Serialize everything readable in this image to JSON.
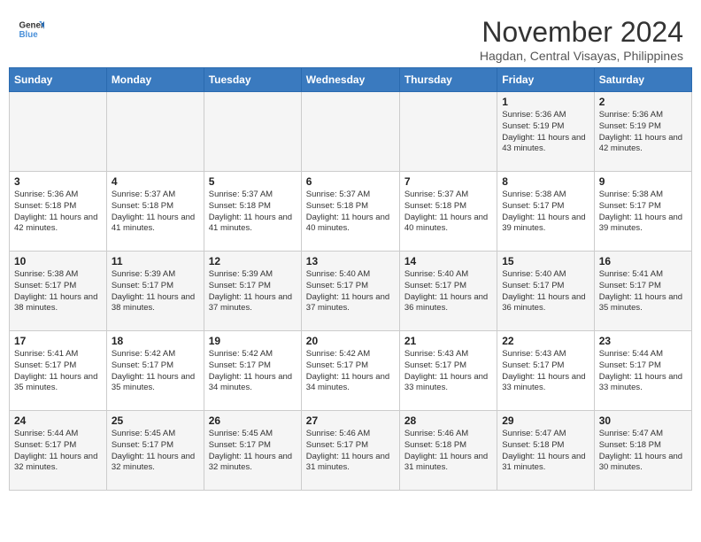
{
  "header": {
    "logo_line1": "General",
    "logo_line2": "Blue",
    "month": "November 2024",
    "location": "Hagdan, Central Visayas, Philippines"
  },
  "days_of_week": [
    "Sunday",
    "Monday",
    "Tuesday",
    "Wednesday",
    "Thursday",
    "Friday",
    "Saturday"
  ],
  "weeks": [
    [
      {
        "day": "",
        "info": ""
      },
      {
        "day": "",
        "info": ""
      },
      {
        "day": "",
        "info": ""
      },
      {
        "day": "",
        "info": ""
      },
      {
        "day": "",
        "info": ""
      },
      {
        "day": "1",
        "info": "Sunrise: 5:36 AM\nSunset: 5:19 PM\nDaylight: 11 hours and 43 minutes."
      },
      {
        "day": "2",
        "info": "Sunrise: 5:36 AM\nSunset: 5:19 PM\nDaylight: 11 hours and 42 minutes."
      }
    ],
    [
      {
        "day": "3",
        "info": "Sunrise: 5:36 AM\nSunset: 5:18 PM\nDaylight: 11 hours and 42 minutes."
      },
      {
        "day": "4",
        "info": "Sunrise: 5:37 AM\nSunset: 5:18 PM\nDaylight: 11 hours and 41 minutes."
      },
      {
        "day": "5",
        "info": "Sunrise: 5:37 AM\nSunset: 5:18 PM\nDaylight: 11 hours and 41 minutes."
      },
      {
        "day": "6",
        "info": "Sunrise: 5:37 AM\nSunset: 5:18 PM\nDaylight: 11 hours and 40 minutes."
      },
      {
        "day": "7",
        "info": "Sunrise: 5:37 AM\nSunset: 5:18 PM\nDaylight: 11 hours and 40 minutes."
      },
      {
        "day": "8",
        "info": "Sunrise: 5:38 AM\nSunset: 5:17 PM\nDaylight: 11 hours and 39 minutes."
      },
      {
        "day": "9",
        "info": "Sunrise: 5:38 AM\nSunset: 5:17 PM\nDaylight: 11 hours and 39 minutes."
      }
    ],
    [
      {
        "day": "10",
        "info": "Sunrise: 5:38 AM\nSunset: 5:17 PM\nDaylight: 11 hours and 38 minutes."
      },
      {
        "day": "11",
        "info": "Sunrise: 5:39 AM\nSunset: 5:17 PM\nDaylight: 11 hours and 38 minutes."
      },
      {
        "day": "12",
        "info": "Sunrise: 5:39 AM\nSunset: 5:17 PM\nDaylight: 11 hours and 37 minutes."
      },
      {
        "day": "13",
        "info": "Sunrise: 5:40 AM\nSunset: 5:17 PM\nDaylight: 11 hours and 37 minutes."
      },
      {
        "day": "14",
        "info": "Sunrise: 5:40 AM\nSunset: 5:17 PM\nDaylight: 11 hours and 36 minutes."
      },
      {
        "day": "15",
        "info": "Sunrise: 5:40 AM\nSunset: 5:17 PM\nDaylight: 11 hours and 36 minutes."
      },
      {
        "day": "16",
        "info": "Sunrise: 5:41 AM\nSunset: 5:17 PM\nDaylight: 11 hours and 35 minutes."
      }
    ],
    [
      {
        "day": "17",
        "info": "Sunrise: 5:41 AM\nSunset: 5:17 PM\nDaylight: 11 hours and 35 minutes."
      },
      {
        "day": "18",
        "info": "Sunrise: 5:42 AM\nSunset: 5:17 PM\nDaylight: 11 hours and 35 minutes."
      },
      {
        "day": "19",
        "info": "Sunrise: 5:42 AM\nSunset: 5:17 PM\nDaylight: 11 hours and 34 minutes."
      },
      {
        "day": "20",
        "info": "Sunrise: 5:42 AM\nSunset: 5:17 PM\nDaylight: 11 hours and 34 minutes."
      },
      {
        "day": "21",
        "info": "Sunrise: 5:43 AM\nSunset: 5:17 PM\nDaylight: 11 hours and 33 minutes."
      },
      {
        "day": "22",
        "info": "Sunrise: 5:43 AM\nSunset: 5:17 PM\nDaylight: 11 hours and 33 minutes."
      },
      {
        "day": "23",
        "info": "Sunrise: 5:44 AM\nSunset: 5:17 PM\nDaylight: 11 hours and 33 minutes."
      }
    ],
    [
      {
        "day": "24",
        "info": "Sunrise: 5:44 AM\nSunset: 5:17 PM\nDaylight: 11 hours and 32 minutes."
      },
      {
        "day": "25",
        "info": "Sunrise: 5:45 AM\nSunset: 5:17 PM\nDaylight: 11 hours and 32 minutes."
      },
      {
        "day": "26",
        "info": "Sunrise: 5:45 AM\nSunset: 5:17 PM\nDaylight: 11 hours and 32 minutes."
      },
      {
        "day": "27",
        "info": "Sunrise: 5:46 AM\nSunset: 5:17 PM\nDaylight: 11 hours and 31 minutes."
      },
      {
        "day": "28",
        "info": "Sunrise: 5:46 AM\nSunset: 5:18 PM\nDaylight: 11 hours and 31 minutes."
      },
      {
        "day": "29",
        "info": "Sunrise: 5:47 AM\nSunset: 5:18 PM\nDaylight: 11 hours and 31 minutes."
      },
      {
        "day": "30",
        "info": "Sunrise: 5:47 AM\nSunset: 5:18 PM\nDaylight: 11 hours and 30 minutes."
      }
    ]
  ]
}
